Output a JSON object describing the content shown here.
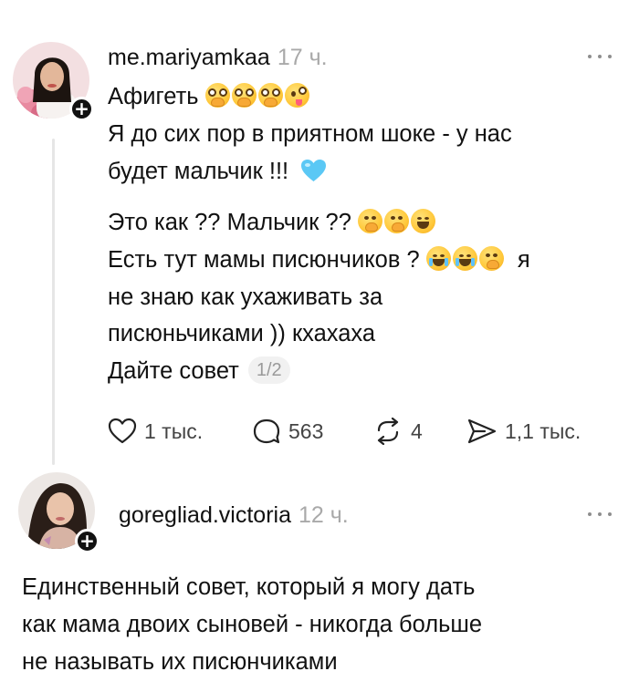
{
  "comment1": {
    "username": "me.mariyamkaa",
    "time": "17 ч.",
    "line1": "Афигеть",
    "line2": "Я до сих пор в приятном шоке - у нас",
    "line3": "будет мальчик !!!",
    "line4": "Это как ?? Мальчик ??",
    "line5": "Есть тут мамы писюнчиков ?",
    "line5_end": "я",
    "line6": "не знаю как ухаживать за",
    "line7": "писюньчиками )) кхахаха",
    "line8": "Дайте совет",
    "pager": "1/2",
    "actions": {
      "likes": "1 тыс.",
      "replies": "563",
      "reposts": "4",
      "shares": "1,1 тыс."
    }
  },
  "comment2": {
    "username": "goregliad.victoria",
    "time": "12 ч.",
    "line1": "Единственный совет, который я могу дать",
    "line2": "как мама двоих сыновей - никогда больше",
    "line3": "не называть их писюнчиками"
  },
  "icons": [
    "plus-icon",
    "more-icon",
    "heart-icon",
    "reply-icon",
    "repost-icon",
    "share-icon"
  ],
  "colors": {
    "accent_heart_emoji": "#5bc8f5",
    "muted_text": "#a9a9a9"
  }
}
